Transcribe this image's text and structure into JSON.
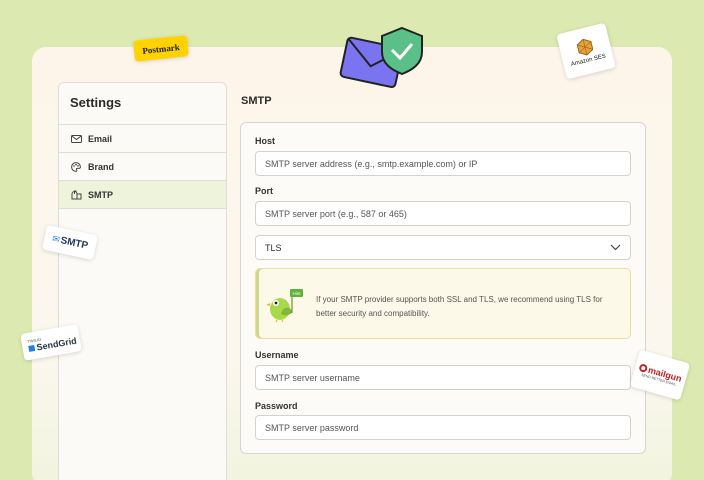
{
  "sidebar": {
    "title": "Settings",
    "items": [
      {
        "label": "Email",
        "icon": "envelope-icon"
      },
      {
        "label": "Brand",
        "icon": "palette-icon"
      },
      {
        "label": "SMTP",
        "icon": "mailbox-icon",
        "active": true
      }
    ]
  },
  "main": {
    "title": "SMTP",
    "host": {
      "label": "Host",
      "placeholder": "SMTP server address (e.g., smtp.example.com) or IP"
    },
    "port": {
      "label": "Port",
      "placeholder": "SMTP server port (e.g., 587 or 465)"
    },
    "encryption": {
      "value": "TLS"
    },
    "tip": {
      "text": "If your SMTP provider supports both SSL and TLS, we recommend using TLS for better security and compatibility.",
      "mascot_sign": "Hint"
    },
    "username": {
      "label": "Username",
      "placeholder": "SMTP server username"
    },
    "password": {
      "label": "Password",
      "placeholder": "SMTP server password"
    }
  },
  "decor": {
    "postmark": "Postmark",
    "smtp": "SMTP",
    "sendgrid_small": "TWILIO",
    "sendgrid": "SendGrid",
    "amazon_ses": "Amazon SES",
    "mailgun": "mailgun",
    "mailgun_sub": "SEND BETTER EMAIL"
  },
  "colors": {
    "background": "#dce9b0",
    "accent": "#eef3dc",
    "envelope": "#7b74f0",
    "shield": "#5bc088"
  }
}
